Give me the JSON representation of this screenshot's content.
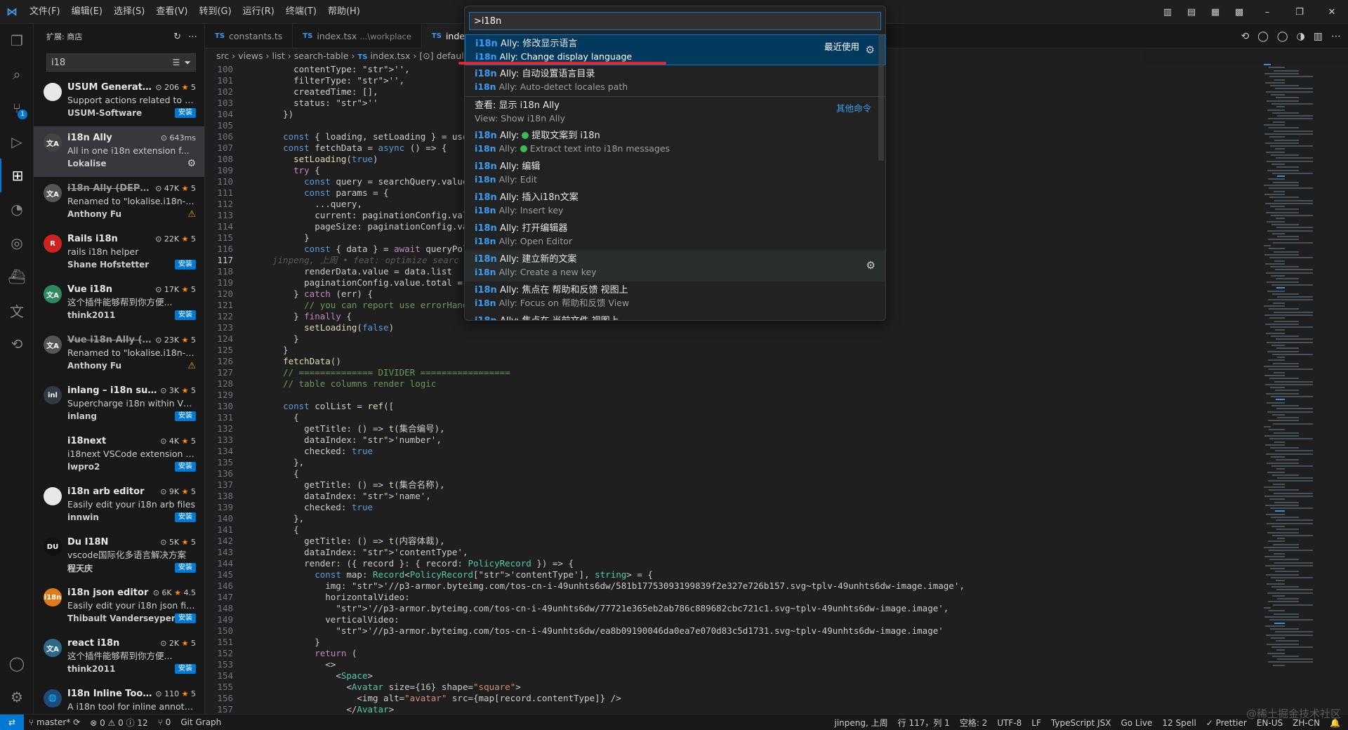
{
  "menubar": [
    "文件(F)",
    "编辑(E)",
    "选择(S)",
    "查看(V)",
    "转到(G)",
    "运行(R)",
    "终端(T)",
    "帮助(H)"
  ],
  "window_controls": {
    "minimize": "–",
    "restore": "❐",
    "close": "✕"
  },
  "sidebar": {
    "title": "扩展: 商店",
    "search_value": "i18",
    "install_label": "安装",
    "extensions": [
      {
        "name": "USUM Generate I...",
        "stats": "206",
        "rating": "5",
        "desc": "Support actions related to i18",
        "publisher": "USUM-Software",
        "action": "install",
        "icon_text": "",
        "icon_color": "#e8e8e8"
      },
      {
        "name": "i18n Ally",
        "stats": "643ms",
        "rating": "",
        "desc": "All in one i18n extension f...",
        "publisher": "Lokalise",
        "action": "gear",
        "icon_text": "文A",
        "icon_color": "#444444"
      },
      {
        "name": "i18n Ally (DEPRE...",
        "stats": "47K",
        "rating": "5",
        "desc": "Renamed to \"lokalise.i18n-ally\"",
        "publisher": "Anthony Fu",
        "action": "warn",
        "icon_text": "文A",
        "icon_color": "#555555"
      },
      {
        "name": "Rails i18n",
        "stats": "22K",
        "rating": "5",
        "desc": "rails i18n helper",
        "publisher": "Shane Hofstetter",
        "action": "install",
        "icon_text": "R",
        "icon_color": "#cc2222"
      },
      {
        "name": "Vue i18n",
        "stats": "17K",
        "rating": "5",
        "desc": "这个插件能够帮到你方便...",
        "publisher": "think2011",
        "action": "install",
        "icon_text": "文A",
        "icon_color": "#2d8a5e"
      },
      {
        "name": "Vue i18n Ally (DE...",
        "stats": "23K",
        "rating": "5",
        "desc": "Renamed to \"lokalise.i18n-ally\"",
        "publisher": "Anthony Fu",
        "action": "warn",
        "icon_text": "文A",
        "icon_color": "#555555"
      },
      {
        "name": "inlang – i18n supe...",
        "stats": "3K",
        "rating": "5",
        "desc": "Supercharge i18n within VS C...",
        "publisher": "inlang",
        "action": "install",
        "icon_text": "inl",
        "icon_color": "#333a44"
      },
      {
        "name": "i18next",
        "stats": "4K",
        "rating": "5",
        "desc": "i18next VSCode extension for ...",
        "publisher": "lwpro2",
        "action": "install",
        "icon_text": "",
        "icon_color": "#181818"
      },
      {
        "name": "i18n arb editor",
        "stats": "9K",
        "rating": "5",
        "desc": "Easily edit your i18n arb files",
        "publisher": "innwin",
        "action": "install",
        "icon_text": "",
        "icon_color": "#e8e8e8"
      },
      {
        "name": "Du I18N",
        "stats": "5K",
        "rating": "5",
        "desc": "vscode国际化多语言解决方案",
        "publisher": "程天庆",
        "action": "install",
        "icon_text": "DU",
        "icon_color": "#111111"
      },
      {
        "name": "i18n json editor",
        "stats": "6K",
        "rating": "4.5",
        "desc": "Easily edit your i18n json files",
        "publisher": "Thibault Vanderseypen",
        "action": "install",
        "icon_text": "i18n",
        "icon_color": "#e07b1a"
      },
      {
        "name": "react i18n",
        "stats": "2K",
        "rating": "5",
        "desc": "这个插件能够帮到你方便...",
        "publisher": "think2011",
        "action": "install",
        "icon_text": "文A",
        "icon_color": "#2d6a8a"
      },
      {
        "name": "I18n Inline Tool f...",
        "stats": "110",
        "rating": "5",
        "desc": "A i18n tool for inline annotati...",
        "publisher": "",
        "action": "none",
        "icon_text": "🌐",
        "icon_color": "#1f4a7a"
      }
    ]
  },
  "tabs": [
    {
      "label": "constants.ts",
      "hint": "",
      "active": false
    },
    {
      "label": "index.tsx",
      "hint": "...\\workplace",
      "active": false
    },
    {
      "label": "inde",
      "hint": "",
      "active": true
    }
  ],
  "breadcrumb": {
    "parts": [
      "src",
      "views",
      "list",
      "search-table"
    ],
    "file": "index.tsx",
    "symbol": "default"
  },
  "code": {
    "current_line": 117,
    "blame": "jinpeng, 上周 • feat: optimize searc",
    "lines": [
      {
        "n": 100,
        "t": "    contentType: '',"
      },
      {
        "n": 101,
        "t": "    filterType: '',"
      },
      {
        "n": 102,
        "t": "    createdTime: [],"
      },
      {
        "n": 103,
        "t": "    status: ''"
      },
      {
        "n": 104,
        "t": "  })"
      },
      {
        "n": 105,
        "t": ""
      },
      {
        "n": 106,
        "t": "  const { loading, setLoading } = useLo"
      },
      {
        "n": 107,
        "t": "  const fetchData = async () => {"
      },
      {
        "n": 108,
        "t": "    setLoading(true)"
      },
      {
        "n": 109,
        "t": "    try {"
      },
      {
        "n": 110,
        "t": "      const query = searchQuery.value"
      },
      {
        "n": 111,
        "t": "      const params = {"
      },
      {
        "n": 112,
        "t": "        ...query,"
      },
      {
        "n": 113,
        "t": "        current: paginationConfig.value"
      },
      {
        "n": 114,
        "t": "        pageSize: paginationConfig.valu"
      },
      {
        "n": 115,
        "t": "      }"
      },
      {
        "n": 116,
        "t": "      const { data } = await queryPolic"
      },
      {
        "n": 117,
        "t": ""
      },
      {
        "n": 118,
        "t": "      renderData.value = data.list"
      },
      {
        "n": 119,
        "t": "      paginationConfig.value.total = da"
      },
      {
        "n": 120,
        "t": "    } catch (err) {"
      },
      {
        "n": 121,
        "t": "      // you can report use errorHandle"
      },
      {
        "n": 122,
        "t": "    } finally {"
      },
      {
        "n": 123,
        "t": "      setLoading(false)"
      },
      {
        "n": 124,
        "t": "    }"
      },
      {
        "n": 125,
        "t": "  }"
      },
      {
        "n": 126,
        "t": "  fetchData()"
      },
      {
        "n": 127,
        "t": "  // ============== DIVIDER ================="
      },
      {
        "n": 128,
        "t": "  // table columns render logic"
      },
      {
        "n": 129,
        "t": ""
      },
      {
        "n": 130,
        "t": "  const colList = ref(["
      },
      {
        "n": 131,
        "t": "    {"
      },
      {
        "n": 132,
        "t": "      getTitle: () => t(集合编号),"
      },
      {
        "n": 133,
        "t": "      dataIndex: 'number',"
      },
      {
        "n": 134,
        "t": "      checked: true"
      },
      {
        "n": 135,
        "t": "    },"
      },
      {
        "n": 136,
        "t": "    {"
      },
      {
        "n": 137,
        "t": "      getTitle: () => t(集合名称),"
      },
      {
        "n": 138,
        "t": "      dataIndex: 'name',"
      },
      {
        "n": 139,
        "t": "      checked: true"
      },
      {
        "n": 140,
        "t": "    },"
      },
      {
        "n": 141,
        "t": "    {"
      },
      {
        "n": 142,
        "t": "      getTitle: () => t(内容体裁),"
      },
      {
        "n": 143,
        "t": "      dataIndex: 'contentType',"
      },
      {
        "n": 144,
        "t": "      render: ({ record }: { record: PolicyRecord }) => {"
      },
      {
        "n": 145,
        "t": "        const map: Record<PolicyRecord['contentType'], string> = {"
      },
      {
        "n": 146,
        "t": "          img: '//p3-armor.byteimg.com/tos-cn-i-49unhts6dw/581b17753093199839f2e327e726b157.svg~tplv-49unhts6dw-image.image',"
      },
      {
        "n": 147,
        "t": "          horizontalVideo:"
      },
      {
        "n": 148,
        "t": "            '//p3-armor.byteimg.com/tos-cn-i-49unhts6dw/77721e365eb2ab786c889682cbc721c1.svg~tplv-49unhts6dw-image.image',"
      },
      {
        "n": 149,
        "t": "          verticalVideo:"
      },
      {
        "n": 150,
        "t": "            '//p3-armor.byteimg.com/tos-cn-i-49unhts6dw/ea8b09190046da0ea7e070d83c5d1731.svg~tplv-49unhts6dw-image.image'"
      },
      {
        "n": 151,
        "t": "        }"
      },
      {
        "n": 152,
        "t": "        return ("
      },
      {
        "n": 153,
        "t": "          <>"
      },
      {
        "n": 154,
        "t": "            <Space>"
      },
      {
        "n": 155,
        "t": "              <Avatar size={16} shape=\"square\">"
      },
      {
        "n": 156,
        "t": "                <img alt=\"avatar\" src={map[record.contentType]} />"
      },
      {
        "n": 157,
        "t": "              </Avatar>"
      }
    ]
  },
  "palette": {
    "query": ">i18n",
    "recent_label": "最近使用",
    "other_label": "其他命令",
    "items": [
      {
        "prefix": "i18n",
        "l1": " Ally: 修改显示语言",
        "l2": " Ally: Change display language",
        "focused": true,
        "dot": false,
        "right": "recent",
        "gear": true
      },
      {
        "prefix": "i18n",
        "l1": " Ally: 自动设置语言目录",
        "l2": " Ally: Auto-detect locales path",
        "focused": false,
        "dot": false,
        "right": "",
        "gear": false
      },
      {
        "prefix": "",
        "l1": "查看: 显示 i18n Ally",
        "l2": "View: Show i18n Ally",
        "focused": false,
        "dot": false,
        "right": "other",
        "gear": false,
        "sep": true
      },
      {
        "prefix": "i18n",
        "l1": " Ally: 提取文案到 i18n",
        "l2": " Ally: Extract text into i18n messages",
        "focused": false,
        "dot": true,
        "right": "",
        "gear": false
      },
      {
        "prefix": "i18n",
        "l1": " Ally: 编辑",
        "l2": " Ally: Edit",
        "focused": false,
        "dot": false,
        "right": "",
        "gear": false
      },
      {
        "prefix": "i18n",
        "l1": " Ally: 插入i18n文案",
        "l2": " Ally: Insert key",
        "focused": false,
        "dot": false,
        "right": "",
        "gear": false
      },
      {
        "prefix": "i18n",
        "l1": " Ally: 打开编辑器",
        "l2": " Ally: Open Editor",
        "focused": false,
        "dot": false,
        "right": "",
        "gear": false
      },
      {
        "prefix": "i18n",
        "l1": " Ally: 建立新的文案",
        "l2": " Ally: Create a new key",
        "focused": false,
        "dot": false,
        "right": "",
        "gear": true,
        "hovered": true
      },
      {
        "prefix": "i18n",
        "l1": " Ally: 焦点在 帮助和反馈 视图上",
        "l2": " Ally: Focus on 帮助和反馈 View",
        "focused": false,
        "dot": false,
        "right": "",
        "gear": false
      },
      {
        "prefix": "i18n",
        "l1": " Ally: 焦点在 当前文件 视图上",
        "l2": "",
        "focused": false,
        "dot": false,
        "right": "",
        "gear": false
      }
    ]
  },
  "statusbar": {
    "branch": "master*",
    "problems": "⊗ 0 ⚠ 0 ⓘ 12",
    "ports": "⑂ 0",
    "git_graph": "Git Graph",
    "author": "jinpeng, 上周",
    "position": "行 117，列 1",
    "spaces": "空格: 2",
    "encoding": "UTF-8",
    "eol": "LF",
    "language": "TypeScript JSX",
    "golive": "Go Live",
    "spell": "12 Spell",
    "prettier": "✓ Prettier",
    "locale1": "EN-US",
    "locale2": "ZH-CN"
  },
  "watermark": "@稀土掘金技术社区"
}
